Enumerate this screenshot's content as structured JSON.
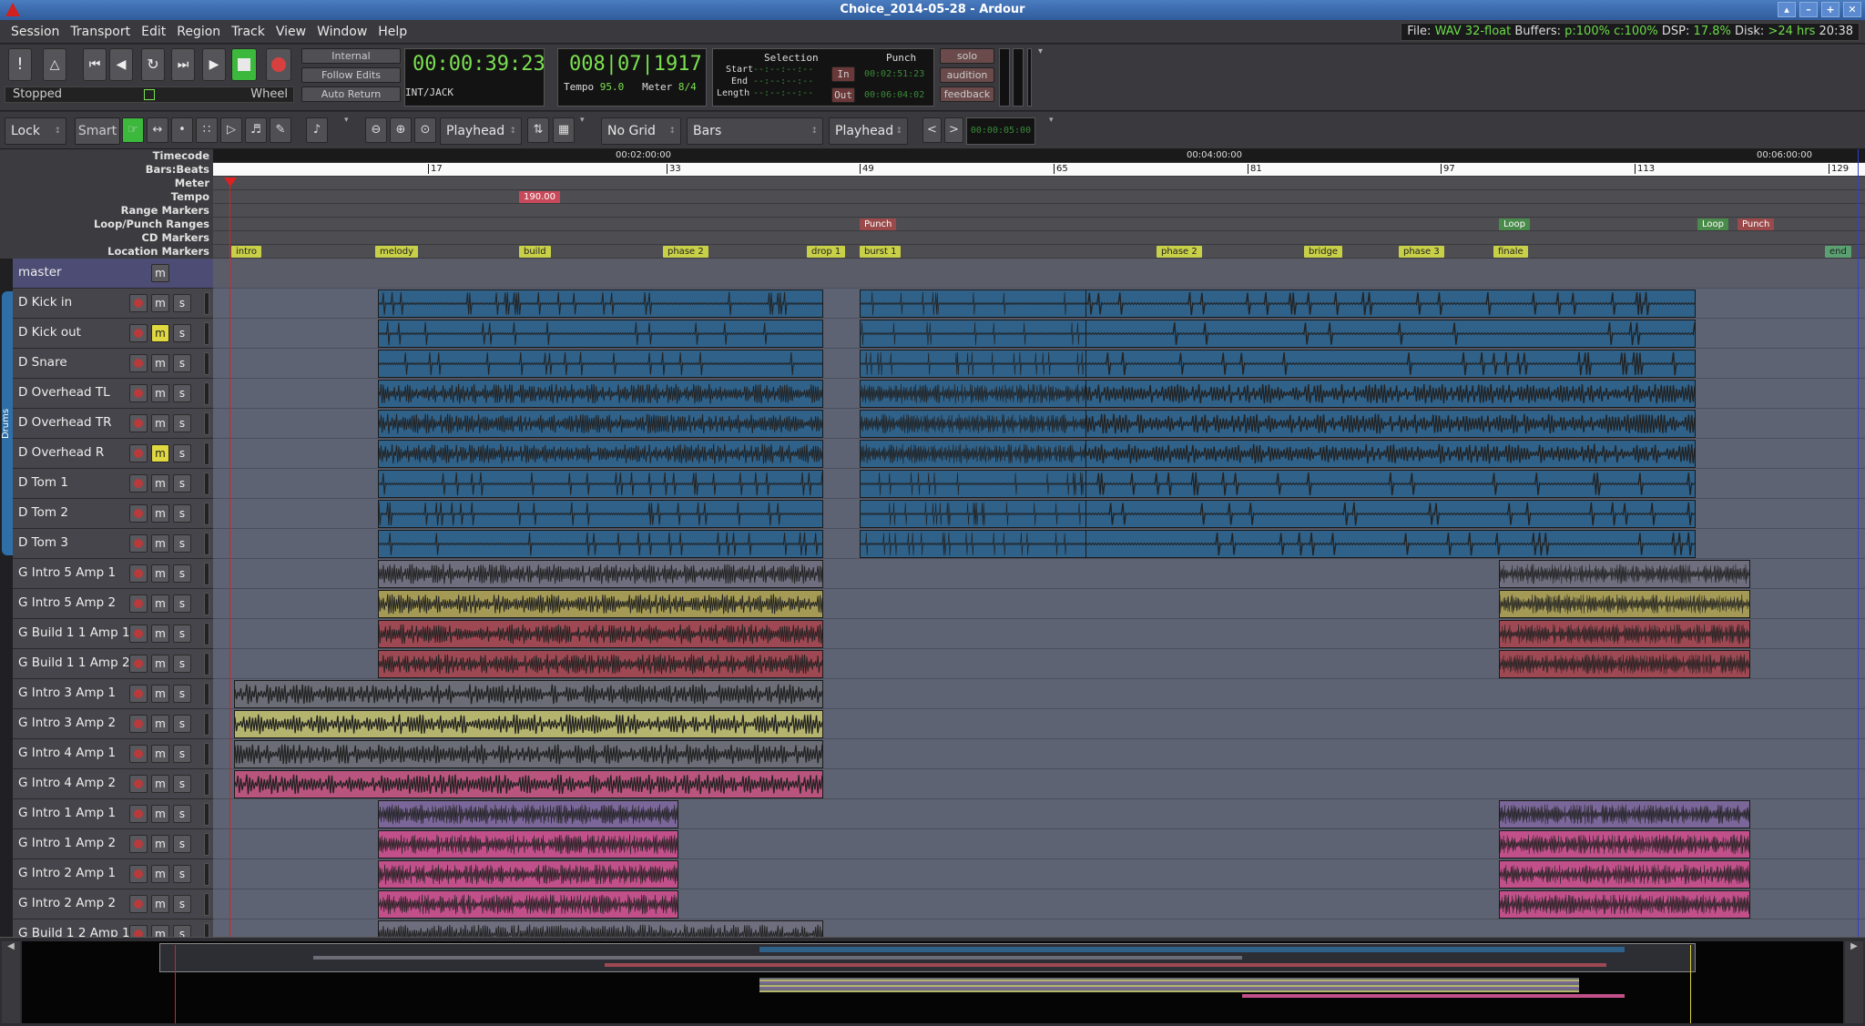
{
  "window": {
    "title": "Choice_2014-05-28 - Ardour"
  },
  "menu": [
    "Session",
    "Transport",
    "Edit",
    "Region",
    "Track",
    "View",
    "Window",
    "Help"
  ],
  "status": {
    "file_label": "File:",
    "file_format": "WAV 32-float",
    "buffers_label": "Buffers:",
    "buffers": "p:100% c:100%",
    "dsp_label": "DSP:",
    "dsp": "17.8%",
    "disk_label": "Disk:",
    "disk": ">24 hrs",
    "time": "20:38"
  },
  "transport": {
    "state": "Stopped",
    "wheel": "Wheel",
    "sync": "Internal",
    "follow_edits": "Follow Edits",
    "auto_return": "Auto Return",
    "primary_clock": "00:00:39:23",
    "clock_mode": "INT/JACK",
    "secondary_clock": "008|07|1917",
    "tempo_label": "Tempo",
    "tempo": "95.0",
    "meter_label": "Meter",
    "meter": "8/4"
  },
  "selection": {
    "title": "Selection",
    "start_label": "Start",
    "end_label": "End",
    "length_label": "Length",
    "value": "--:--:--:--"
  },
  "punch": {
    "title": "Punch",
    "in": "In",
    "out": "Out",
    "in_time": "00:02:51:23",
    "out_time": "00:06:04:02"
  },
  "monitor": {
    "solo": "solo",
    "audition": "audition",
    "feedback": "feedback"
  },
  "edit_toolbar": {
    "lock": "Lock",
    "smart": "Smart",
    "edit_point": "Playhead",
    "grid": "No Grid",
    "grid_unit": "Bars",
    "nudge_point": "Playhead",
    "nudge_clock": "00:00:05:00"
  },
  "ruler_labels": [
    "Timecode",
    "Bars:Beats",
    "Meter",
    "Tempo",
    "Range Markers",
    "Loop/Punch Ranges",
    "CD Markers",
    "Location Markers"
  ],
  "timecode_ticks": [
    "00:02:00:00",
    "00:04:00:00",
    "00:06:00:00"
  ],
  "bar_ticks": [
    "17",
    "33",
    "49",
    "65",
    "81",
    "97",
    "113",
    "129"
  ],
  "tempo_marker": "190.00",
  "loop_punch": [
    "Punch",
    "Loop",
    "Loop",
    "Punch"
  ],
  "location_markers": [
    "intro",
    "melody",
    "build",
    "phase 2",
    "drop 1",
    "burst 1",
    "phase 2",
    "bridge",
    "phase 3",
    "finale",
    "end"
  ],
  "master": {
    "name": "master",
    "m": "m"
  },
  "drum_group": "Drums",
  "tracks": [
    {
      "name": "D Kick in",
      "mute": false
    },
    {
      "name": "D Kick out",
      "mute": true
    },
    {
      "name": "D Snare",
      "mute": false
    },
    {
      "name": "D Overhead TL",
      "mute": false
    },
    {
      "name": "D Overhead TR",
      "mute": false
    },
    {
      "name": "D Overhead R",
      "mute": true
    },
    {
      "name": "D Tom 1",
      "mute": false
    },
    {
      "name": "D Tom 2",
      "mute": false
    },
    {
      "name": "D Tom 3",
      "mute": false
    },
    {
      "name": "G Intro 5 Amp 1",
      "mute": false
    },
    {
      "name": "G Intro 5 Amp 2",
      "mute": false
    },
    {
      "name": "G Build 1 1 Amp 1",
      "mute": false
    },
    {
      "name": "G Build 1 1 Amp 2",
      "mute": false
    },
    {
      "name": "G Intro 3 Amp 1",
      "mute": false
    },
    {
      "name": "G Intro 3 Amp 2",
      "mute": false
    },
    {
      "name": "G Intro 4 Amp 1",
      "mute": false
    },
    {
      "name": "G Intro 4 Amp 2",
      "mute": false
    },
    {
      "name": "G Intro 1 Amp 1",
      "mute": false
    },
    {
      "name": "G Intro 1 Amp 2",
      "mute": false
    },
    {
      "name": "G Intro 2 Amp 1",
      "mute": false
    },
    {
      "name": "G Intro 2 Amp 2",
      "mute": false
    },
    {
      "name": "G Build 1 2 Amp 1",
      "mute": false
    }
  ],
  "btn": {
    "m": "m",
    "s": "s"
  },
  "colors": {
    "drum_region": "#2f6189",
    "amp1": "#6e6e7e",
    "amp2_yellow": "#a49a55",
    "build_red": "#9d4852",
    "intro3_gray": "#6a6d76",
    "intro3_yellow": "#b5b46e",
    "intro4_pink": "#b8547d",
    "intro1_purple": "#7a6698",
    "intro1_pink": "#c1508a"
  }
}
